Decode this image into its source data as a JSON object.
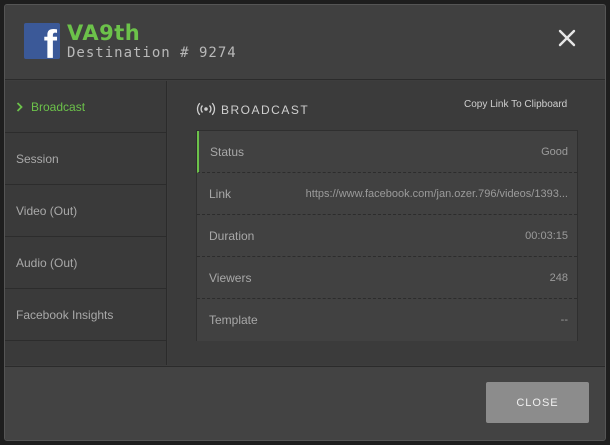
{
  "header": {
    "title": "VA9th",
    "subtitle": "Destination # 9274",
    "logo_icon": "facebook-logo",
    "logo_letter": "f",
    "close_icon": "close-icon"
  },
  "sidebar": {
    "items": [
      {
        "label": "Broadcast",
        "active": true
      },
      {
        "label": "Session",
        "active": false
      },
      {
        "label": "Video (Out)",
        "active": false
      },
      {
        "label": "Audio (Out)",
        "active": false
      },
      {
        "label": "Facebook Insights",
        "active": false
      }
    ]
  },
  "main": {
    "section_icon": "broadcast-icon",
    "section_title": "BROADCAST",
    "copy_link_label": "Copy Link To Clipboard",
    "rows": [
      {
        "key": "Status",
        "value": "Good"
      },
      {
        "key": "Link",
        "value": "https://www.facebook.com/jan.ozer.796/videos/1393..."
      },
      {
        "key": "Duration",
        "value": "00:03:15"
      },
      {
        "key": "Viewers",
        "value": "248"
      },
      {
        "key": "Template",
        "value": "--"
      }
    ]
  },
  "footer": {
    "close_label": "CLOSE"
  },
  "colors": {
    "accent": "#6cc24a",
    "facebook_blue": "#3b5998"
  }
}
